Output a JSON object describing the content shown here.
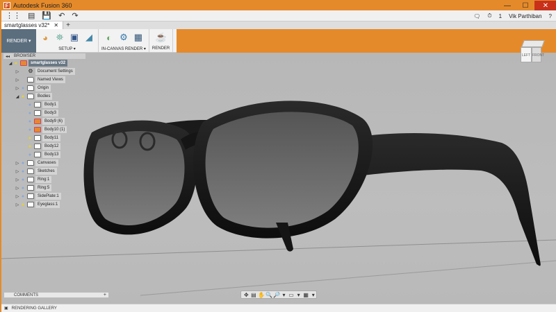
{
  "window": {
    "app_badge": "F",
    "title": "Autodesk Fusion 360",
    "controls": {
      "minimize": "—",
      "maximize": "☐",
      "close": "✕"
    }
  },
  "qat": {
    "grid_icon": "⋮⋮",
    "file_icon": "▤",
    "save_icon": "💾",
    "undo_icon": "↶",
    "redo_icon": "↷",
    "chat_icon": "🗨",
    "clock_icon": "⏱",
    "notification_count": "1",
    "user_name": "Vik Parthiban",
    "help_icon": "?"
  },
  "tabs": [
    {
      "label": "smartglasses v32*",
      "close": "✕"
    }
  ],
  "tab_add": "+",
  "ribbon": {
    "workspace": "RENDER ▾",
    "panels": [
      {
        "label": "SETUP ▾",
        "icons": [
          "◕",
          "⛯",
          "▣",
          "◢"
        ]
      },
      {
        "label": "IN-CANVAS RENDER ▾",
        "icons": [
          "◐",
          "⚙",
          "▦"
        ]
      },
      {
        "label": "RENDER",
        "icons": [
          "☕"
        ]
      }
    ]
  },
  "browser": {
    "collapse": "◂◂",
    "title": "BROWSER",
    "items": [
      {
        "arrow": "◢",
        "bulb": "💡",
        "icon": "warn",
        "label": "smartglasses v32",
        "root": true,
        "indent": 0
      },
      {
        "arrow": "▷",
        "bulb": "",
        "icon": "gear",
        "label": "Document Settings",
        "indent": 1
      },
      {
        "arrow": "▷",
        "bulb": "",
        "icon": "folder",
        "label": "Named Views",
        "indent": 1
      },
      {
        "arrow": "▷",
        "bulb": "💡",
        "icon": "folder",
        "label": "Origin",
        "indent": 1
      },
      {
        "arrow": "◢",
        "bulb": "💡",
        "icon": "folder",
        "label": "Bodies",
        "indent": 1
      },
      {
        "arrow": "",
        "bulb": "💡",
        "icon": "box",
        "label": "Body1",
        "indent": 2
      },
      {
        "arrow": "",
        "bulb": "💡",
        "icon": "box",
        "label": "Body3",
        "indent": 2
      },
      {
        "arrow": "",
        "bulb": "💡",
        "icon": "warn",
        "label": "Body9 (6)",
        "indent": 2
      },
      {
        "arrow": "",
        "bulb": "💡",
        "icon": "warn",
        "label": "Body10 (1)",
        "indent": 2
      },
      {
        "arrow": "",
        "bulb": "💡",
        "icon": "box",
        "label": "Body11",
        "indent": 2
      },
      {
        "arrow": "",
        "bulb": "💡",
        "icon": "box",
        "label": "Body12",
        "indent": 2
      },
      {
        "arrow": "",
        "bulb": "💡",
        "icon": "box",
        "label": "Body13",
        "indent": 2
      },
      {
        "arrow": "▷",
        "bulb": "💡",
        "icon": "folder",
        "label": "Canvases",
        "indent": 1
      },
      {
        "arrow": "▷",
        "bulb": "💡",
        "icon": "folder",
        "label": "Sketches",
        "indent": 1
      },
      {
        "arrow": "▷",
        "bulb": "💡",
        "icon": "box",
        "label": "Ring:1",
        "indent": 1
      },
      {
        "arrow": "▷",
        "bulb": "💡",
        "icon": "box",
        "label": "Ring:5",
        "indent": 1
      },
      {
        "arrow": "▷",
        "bulb": "💡",
        "icon": "box",
        "label": "SidePlate:1",
        "indent": 1
      },
      {
        "arrow": "▷",
        "bulb": "💡",
        "icon": "box",
        "label": "Eyeglass:1",
        "indent": 1
      }
    ]
  },
  "viewcube": {
    "left": "LEFT",
    "right": "FRONT"
  },
  "comments": {
    "collapse": "◂◂",
    "label": "COMMENTS",
    "add": "+"
  },
  "navbar": {
    "icons": [
      "✥",
      "▤",
      "✋",
      "🔍",
      "🔎",
      "▾",
      "▭",
      "▾",
      "▦",
      "▾"
    ]
  },
  "status": {
    "icon": "▣",
    "label": "RENDERING GALLERY"
  }
}
